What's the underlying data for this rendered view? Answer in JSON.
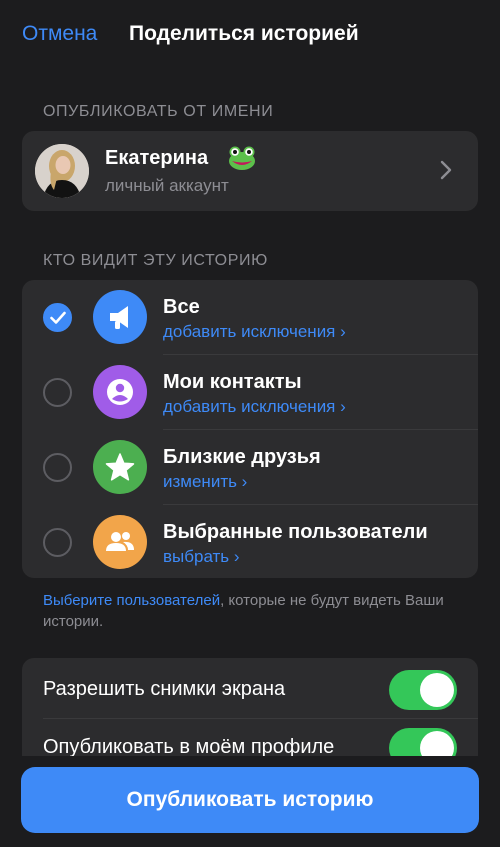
{
  "header": {
    "cancel_label": "Отмена",
    "title": "Поделиться историей"
  },
  "sections": {
    "publish_as": "ОПУБЛИКОВАТЬ ОТ ИМЕНИ",
    "who_sees": "КТО ВИДИТ ЭТУ ИСТОРИЮ"
  },
  "account": {
    "name": "Екатерина",
    "subtitle": "личный аккаунт",
    "emoji_icon": "frog-emoji-icon"
  },
  "audience": [
    {
      "title": "Все",
      "link": "добавить исключения ›",
      "selected": true,
      "icon": "megaphone-icon",
      "color": "#3e8af7"
    },
    {
      "title": "Мои контакты",
      "link": "добавить исключения ›",
      "selected": false,
      "icon": "person-circle-icon",
      "color": "#a05ce8"
    },
    {
      "title": "Близкие друзья",
      "link": "изменить ›",
      "selected": false,
      "icon": "star-icon",
      "color": "#4caf50"
    },
    {
      "title": "Выбранные пользователи",
      "link": "выбрать ›",
      "selected": false,
      "icon": "people-icon",
      "color": "#f2a54a"
    }
  ],
  "note": {
    "link": "Выберите пользователей",
    "rest": ", которые не будут видеть Ваши истории."
  },
  "toggles": [
    {
      "label": "Разрешить снимки экрана",
      "on": true
    },
    {
      "label": "Опубликовать в моём профиле",
      "on": true
    }
  ],
  "publish_label": "Опубликовать историю",
  "colors": {
    "accent": "#3e8af7",
    "background": "#1c1c1e",
    "card": "#2c2c2e",
    "toggle_on": "#34c759"
  }
}
